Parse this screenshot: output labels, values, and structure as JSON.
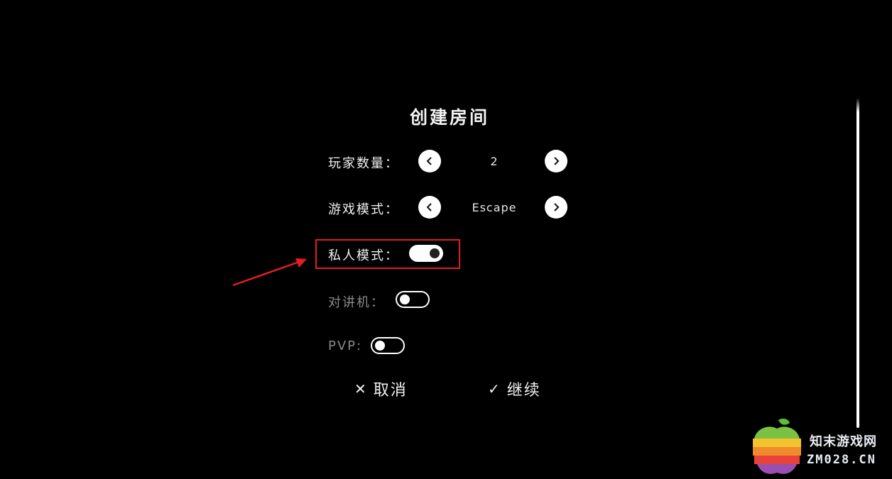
{
  "dialog": {
    "title": "创建房间",
    "player_count": {
      "label": "玩家数量：",
      "value": "2"
    },
    "game_mode": {
      "label": "游戏模式：",
      "value": "Escape"
    },
    "private_mode": {
      "label": "私人模式：",
      "state": "on"
    },
    "walkie_talkie": {
      "label": "对讲机：",
      "state": "off"
    },
    "pvp": {
      "label": "PVP:",
      "state": "off"
    },
    "cancel_label": "取消",
    "cancel_glyph": "✕",
    "continue_label": "继续",
    "continue_glyph": "✓"
  },
  "icons": {
    "prev": "chevron-left-icon",
    "next": "chevron-right-icon"
  },
  "annotation": {
    "highlight_color": "#e02020"
  },
  "watermark": {
    "line1": "知末游戏网",
    "line2": "ZM028.CN"
  },
  "colors": {
    "background": "#000000",
    "text": "#f0f0f0",
    "dim_text": "#8a8a8a"
  }
}
